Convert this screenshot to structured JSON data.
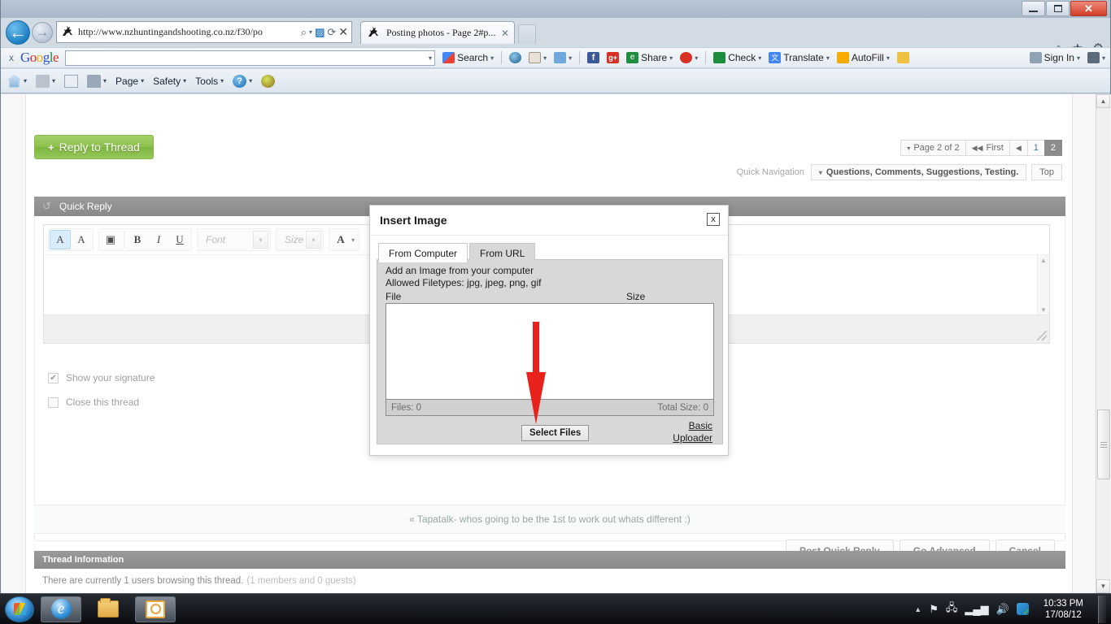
{
  "window": {
    "minimize_label": "Minimize",
    "restore_label": "Restore",
    "close_label": "✕"
  },
  "browser": {
    "back_glyph": "←",
    "forward_glyph": "→",
    "url": "http://www.nzhuntingandshooting.co.nz/f30/po",
    "address_icons": {
      "search_glyph": "⌕",
      "caret_glyph": "▾",
      "compat_glyph": "▨",
      "refresh_glyph": "⟳",
      "stop_glyph": "✕"
    },
    "tab_title": "Posting photos - Page 2#p...",
    "tab_close_glyph": "✕",
    "right_icons": {
      "home_glyph": "⌂",
      "favorites_glyph": "★",
      "tools_glyph": "⚙"
    }
  },
  "google_toolbar": {
    "close_label": "x",
    "logo": [
      "G",
      "o",
      "o",
      "g",
      "l",
      "e"
    ],
    "search_value": "",
    "items": [
      {
        "label": "Search",
        "icon": "google-search-icon",
        "caret": true
      },
      {
        "label": "",
        "icon": "globe-icon",
        "caret": false
      },
      {
        "label": "",
        "icon": "news-icon",
        "caret": true
      },
      {
        "label": "",
        "icon": "plus-icon",
        "caret": true
      },
      {
        "label": "",
        "icon": "facebook-icon",
        "caret": false
      },
      {
        "label": "",
        "icon": "google-plus-icon",
        "caret": false
      },
      {
        "label": "Share",
        "icon": "share-icon",
        "caret": true
      },
      {
        "label": "",
        "icon": "red-share-icon",
        "caret": true
      },
      {
        "label": "Check",
        "icon": "spellcheck-icon",
        "caret": true
      },
      {
        "label": "Translate",
        "icon": "translate-icon",
        "caret": true
      },
      {
        "label": "AutoFill",
        "icon": "autofill-icon",
        "caret": true
      },
      {
        "label": "",
        "icon": "highlighter-icon",
        "caret": false
      }
    ],
    "sign_in_label": "Sign In",
    "caret_glyph": "▾"
  },
  "command_bar": {
    "items": [
      {
        "label": "",
        "icon": "home-icon",
        "caret": true
      },
      {
        "label": "",
        "icon": "rss-icon",
        "caret": true
      },
      {
        "label": "",
        "icon": "mail-icon",
        "caret": false
      },
      {
        "label": "",
        "icon": "print-icon",
        "caret": true
      },
      {
        "label": "Page",
        "icon": "",
        "caret": true
      },
      {
        "label": "Safety",
        "icon": "",
        "caret": true
      },
      {
        "label": "Tools",
        "icon": "",
        "caret": true
      },
      {
        "label": "",
        "icon": "help-icon",
        "caret": true
      },
      {
        "label": "",
        "icon": "eye-icon",
        "caret": false
      }
    ],
    "caret_glyph": "▾"
  },
  "forum": {
    "reply_thread_label": "Reply to Thread",
    "reply_thread_plus": "+",
    "pagination": {
      "page_label": "Page 2 of 2",
      "first_label": "First",
      "prev_glyph": "◀",
      "first_glyph": "◀◀",
      "caret_glyph": "▾",
      "pages": [
        "1",
        "2"
      ],
      "current_page": "2"
    },
    "quick_navigation": {
      "label": "Quick Navigation",
      "selected": "Questions, Comments, Suggestions, Testing.",
      "caret_glyph": "▾",
      "top_label": "Top"
    },
    "quick_reply": {
      "header": "Quick Reply",
      "header_icon_glyph": "↺",
      "toolbar": {
        "remove_format_label": "A",
        "color_format_label": "A",
        "image_label": "▣",
        "bold_label": "B",
        "italic_label": "I",
        "underline_label": "U",
        "font_placeholder": "Font",
        "size_placeholder": "Size",
        "font_color_label": "A",
        "dropdown_caret": "▾"
      },
      "message_value": "",
      "scroll_up_glyph": "▲",
      "scroll_down_glyph": "▼"
    },
    "checkboxes": [
      {
        "label": "Show your signature",
        "checked": true,
        "check_glyph": "✔"
      },
      {
        "label": "Close this thread",
        "checked": false,
        "check_glyph": ""
      }
    ],
    "buttons": [
      {
        "label": "Post Quick Reply"
      },
      {
        "label": "Go Advanced"
      },
      {
        "label": "Cancel"
      }
    ],
    "tapatalk_notice": "« Tapatalk- whos going to be the 1st to work out whats different :)",
    "thread_information": {
      "header": "Thread Information",
      "text": "There are currently 1 users browsing this thread.",
      "muted": "(1 members and 0 guests)"
    }
  },
  "modal": {
    "title": "Insert Image",
    "close_label": "x",
    "tabs": [
      {
        "label": "From Computer",
        "active": true
      },
      {
        "label": "From URL",
        "active": false
      }
    ],
    "description": "Add an Image from your computer",
    "allowed_filetypes": "Allowed Filetypes: jpg, jpeg, png, gif",
    "columns": {
      "file": "File",
      "size": "Size"
    },
    "files_count": "Files: 0",
    "total_size": "Total Size: 0",
    "select_files_label": "Select Files",
    "basic_uploader_label": "Basic Uploader"
  },
  "page_scrollbar": {
    "up_glyph": "▲",
    "down_glyph": "▼"
  },
  "taskbar": {
    "start_label": "Start",
    "tasks": [
      {
        "name": "internet-explorer",
        "active": true
      },
      {
        "name": "windows-explorer",
        "active": false
      },
      {
        "name": "outlook",
        "active": true
      }
    ],
    "tray": {
      "expand_glyph": "▲",
      "flag_glyph": "⚑",
      "devices_glyph": "🖧",
      "network_glyph": "▂▄▆",
      "volume_glyph": "🔊",
      "dropbox_name": "dropbox-icon"
    },
    "clock_time": "10:33 PM",
    "clock_date": "17/08/12"
  },
  "annotation": {
    "arrow_color": "#e8211c",
    "name": "red-down-arrow-annotation"
  }
}
